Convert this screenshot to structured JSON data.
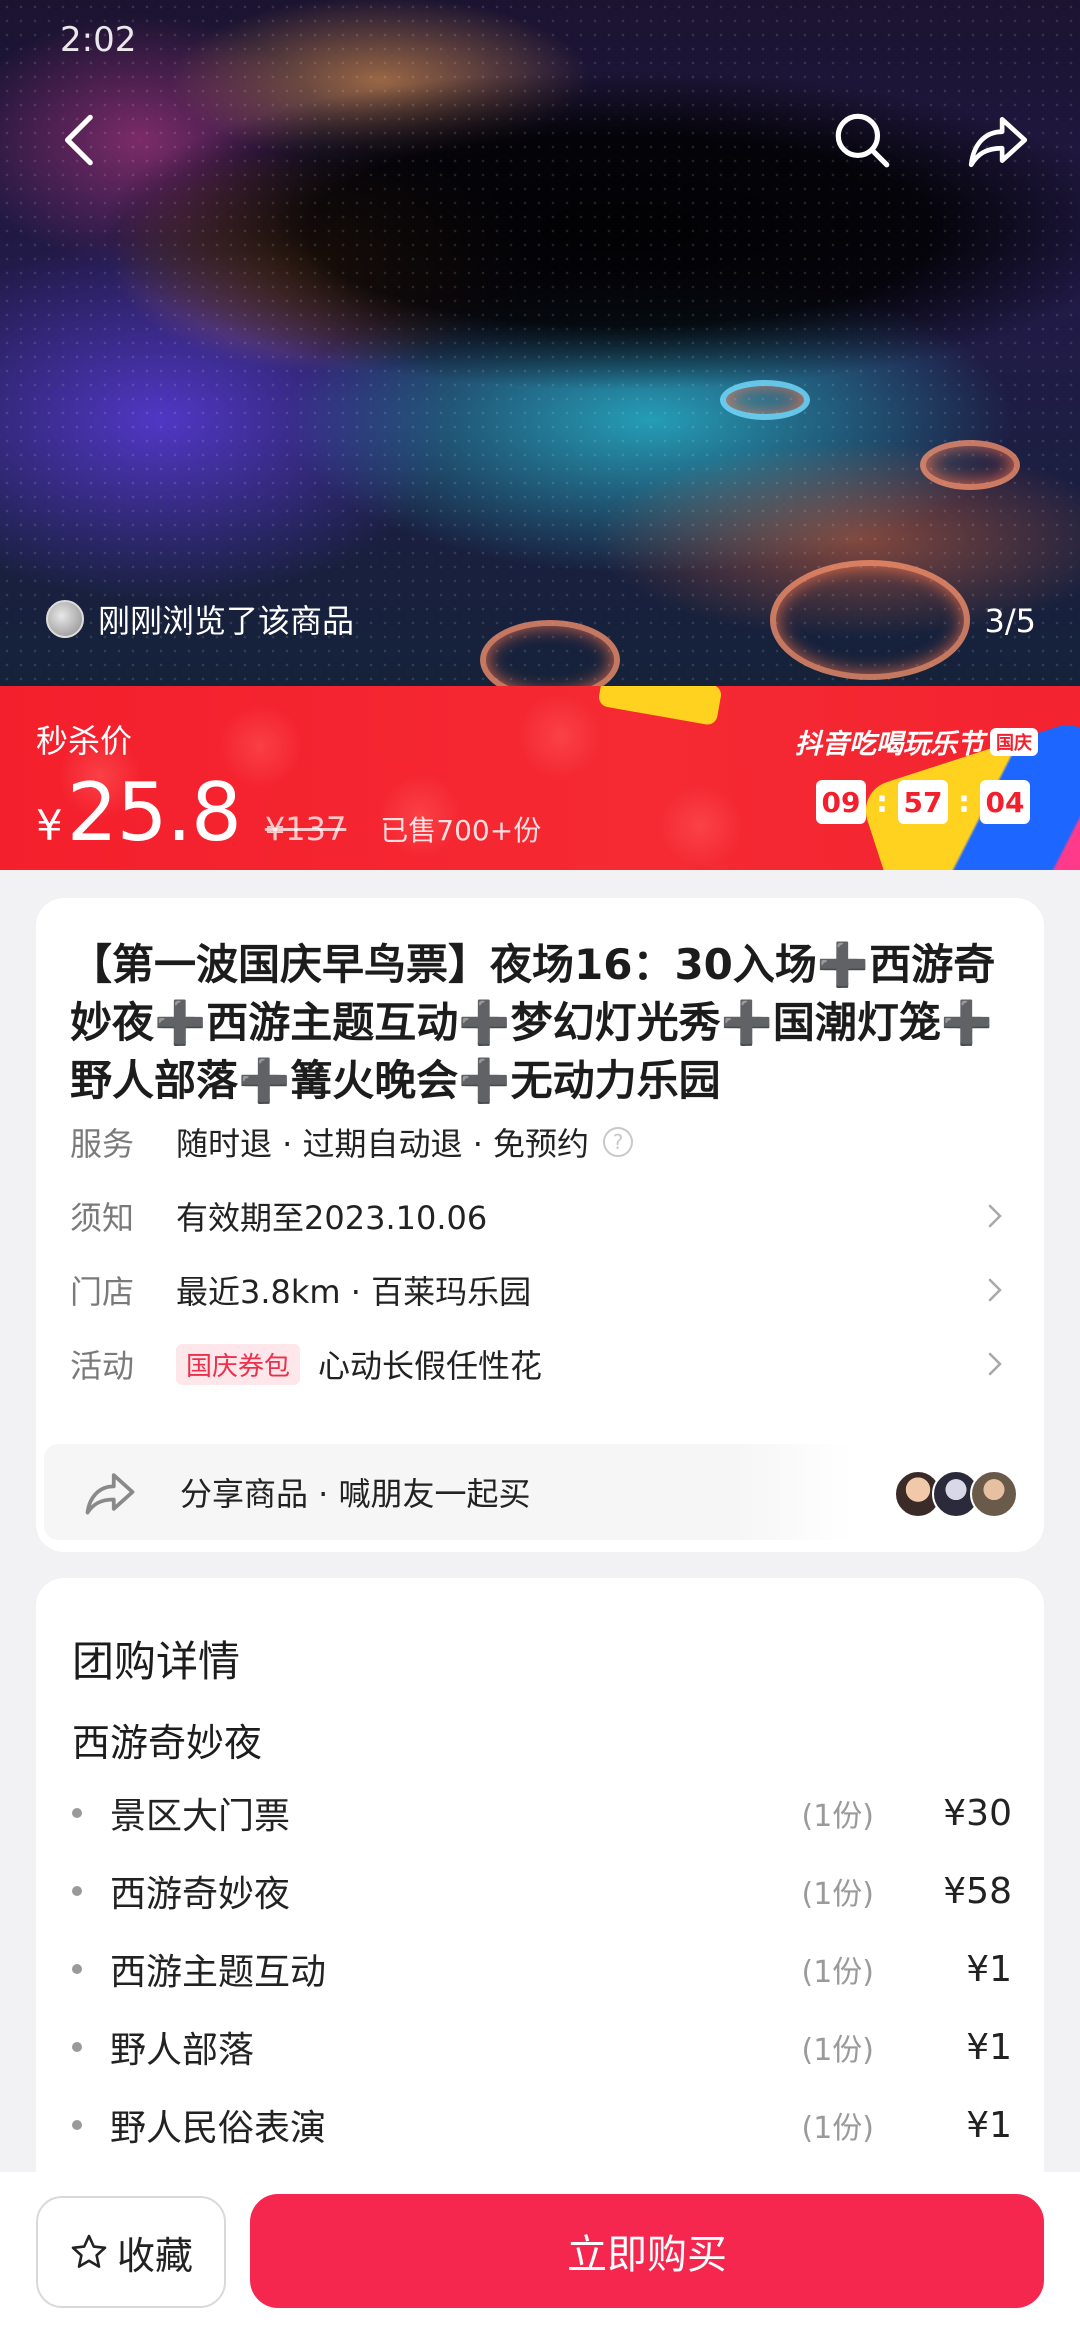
{
  "status_bar": {
    "time": "2:02"
  },
  "hero": {
    "browse_note": "刚刚浏览了该商品",
    "image_counter": "3/5"
  },
  "price_banner": {
    "label": "秒杀价",
    "currency": "¥",
    "price": "25.8",
    "original_price": "¥137",
    "sold": "已售700+份",
    "festival_title": "抖音吃喝玩乐节",
    "festival_tag": "国庆",
    "countdown": {
      "hours": "09",
      "minutes": "57",
      "seconds": "04"
    }
  },
  "product": {
    "title": "【第一波国庆早鸟票】夜场16：30入场➕西游奇妙夜➕西游主题互动➕梦幻灯光秀➕国潮灯笼➕野人部落➕篝火晚会➕无动力乐园",
    "rows": [
      {
        "label": "服务",
        "value": "随时退 · 过期自动退 · 免预约"
      },
      {
        "label": "须知",
        "value": "有效期至2023.10.06"
      },
      {
        "label": "门店",
        "value": "最近3.8km · 百莱玛乐园"
      },
      {
        "label": "活动",
        "badge": "国庆券包",
        "value": "心动长假任性花"
      }
    ],
    "share_text": "分享商品 · 喊朋友一起买"
  },
  "details": {
    "heading": "团购详情",
    "subheading": "西游奇妙夜",
    "items": [
      {
        "name": "景区大门票",
        "qty": "(1份)",
        "price": "¥30"
      },
      {
        "name": "西游奇妙夜",
        "qty": "(1份)",
        "price": "¥58"
      },
      {
        "name": "西游主题互动",
        "qty": "(1份)",
        "price": "¥1"
      },
      {
        "name": "野人部落",
        "qty": "(1份)",
        "price": "¥1"
      },
      {
        "name": "野人民俗表演",
        "qty": "(1份)",
        "price": "¥1"
      }
    ]
  },
  "bottom_bar": {
    "favorite_label": "收藏",
    "buy_label": "立即购买"
  },
  "colors": {
    "price_banner_red": "#f41f2c",
    "buy_button": "#f5274f",
    "activity_badge_text": "#ee2f4b"
  },
  "icons": [
    "back-arrow-icon",
    "search-icon",
    "share-icon",
    "help-icon",
    "chevron-right-icon",
    "star-icon"
  ]
}
